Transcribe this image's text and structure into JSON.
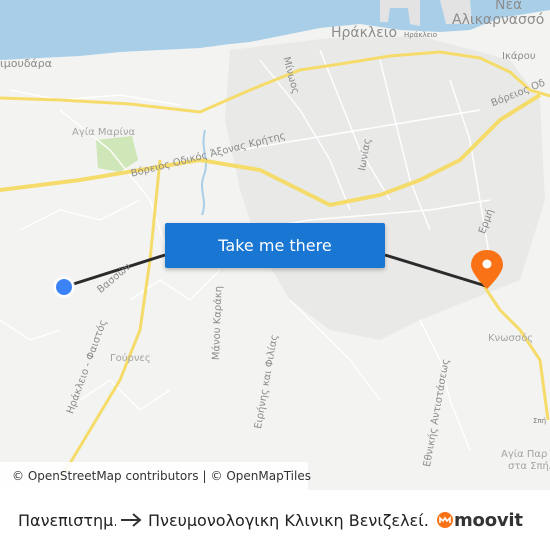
{
  "map": {
    "labels": {
      "city_herakleio": "Ηράκλειο",
      "city_herakleio_small": "Ηράκλειο",
      "city_nea": "Νέα",
      "city_alikarnassos": "Αλικαρνασσό",
      "city_amoudara": "ιμουδάρα",
      "area_agia_marina": "Αγία Μαρίνα",
      "road_voreios_axonas": "Βόρειος Οδικός Άξονας Κρήτης",
      "road_voreios_right": "Βόρειος Οδ",
      "road_minos": "Μίνωος",
      "road_ionias": "Ιωνίας",
      "road_ikarou": "Ικάρου",
      "road_erithi": "Ερμή",
      "road_vassilon": "Βασσών",
      "road_irakleio_faistos": "Ηράκλειο - Φαιστός",
      "area_gournes": "Γούρνες",
      "road_manou_karaki": "Μάνου Καράκη",
      "road_eirinis_filias": "Ειρήνης και Φιλίας",
      "road_ethnikis_antistasis": "Εθνικής Αντιστάσεως",
      "area_knossos": "Κνωσσός",
      "area_agia_paraskevi_1": "Αγία Παρ",
      "area_agia_paraskevi_2": "στα Σπήλ",
      "area_spi": "Σπή"
    },
    "route": {
      "origin_marker_color": "#3b82f6",
      "destination_marker_color": "#f97316"
    }
  },
  "cta": {
    "label": "Take me there"
  },
  "attribution": {
    "osm_contributors": "© OpenStreetMap contributors",
    "separator": "|",
    "openmaptiles": "© OpenMapTiles"
  },
  "footer": {
    "from": "Πανεπιστημ…",
    "to": "Πνευμονολογικη Κλινικη Βενιζελεί…",
    "logo_text": "moovit",
    "brand_color": "#f97316"
  }
}
